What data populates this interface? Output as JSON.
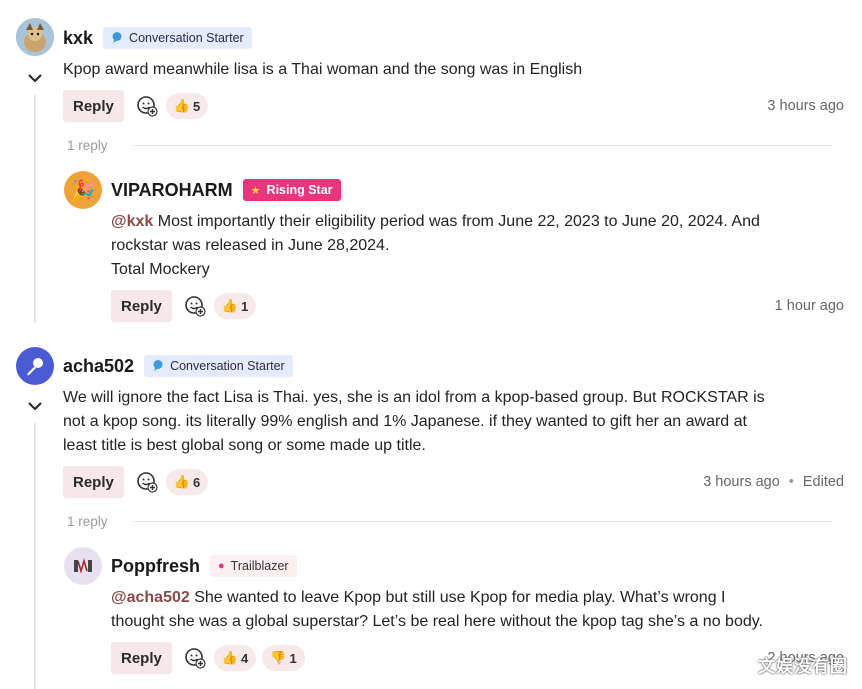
{
  "comments": [
    {
      "username": "kxk",
      "badge": "Conversation Starter",
      "text": "Kpop award meanwhile lisa is a Thai woman and the song was in English",
      "reply_label": "Reply",
      "likes": "5",
      "time": "3 hours ago",
      "replies_count": "1 reply"
    },
    {
      "username": "VIPAROHARM",
      "badge": "Rising Star",
      "mention": "@kxk",
      "text_line1": " Most importantly their eligibility period was from June 22, 2023 to June 20, 2024. And",
      "text_line2": "rockstar was released in June 28,2024.",
      "text_line3": "Total Mockery",
      "reply_label": "Reply",
      "likes": "1",
      "time": "1 hour ago"
    },
    {
      "username": "acha502",
      "badge": "Conversation Starter",
      "text_line1": "We will ignore the fact Lisa is Thai. yes, she is an idol from a kpop-based group. But ROCKSTAR is",
      "text_line2": "not a kpop song. its literally 99% english and 1% Japanese. if they wanted to gift her an award at",
      "text_line3": "least title is best global song or some made up title.",
      "reply_label": "Reply",
      "likes": "6",
      "time": "3 hours ago",
      "edited": "Edited",
      "replies_count": "1 reply"
    },
    {
      "username": "Poppfresh",
      "badge": "Trailblazer",
      "mention": "@acha502",
      "text_line1": " She wanted to leave Kpop but still use Kpop for media play. What’s wrong I",
      "text_line2": "thought she was a global superstar? Let’s be real here without the kpop tag she’s a no body.",
      "reply_label": "Reply",
      "likes": "4",
      "dislikes": "1",
      "time": "2 hours ago"
    }
  ],
  "watermark": "文娱没有圈",
  "colors": {
    "reply_bg": "#f6e8e8",
    "badge_blue_bg": "#e4ebfa",
    "badge_pink_bg": "#e8357e",
    "mention": "#8a4a4a",
    "acha_avatar": "#4a5bd4"
  },
  "icons": [
    "caret-down-icon",
    "add-reaction-icon",
    "thumbs-up-icon",
    "thumbs-down-icon",
    "speech-bubble-icon",
    "star-icon",
    "microphone-icon",
    "accordion-icon",
    "party-icon"
  ]
}
